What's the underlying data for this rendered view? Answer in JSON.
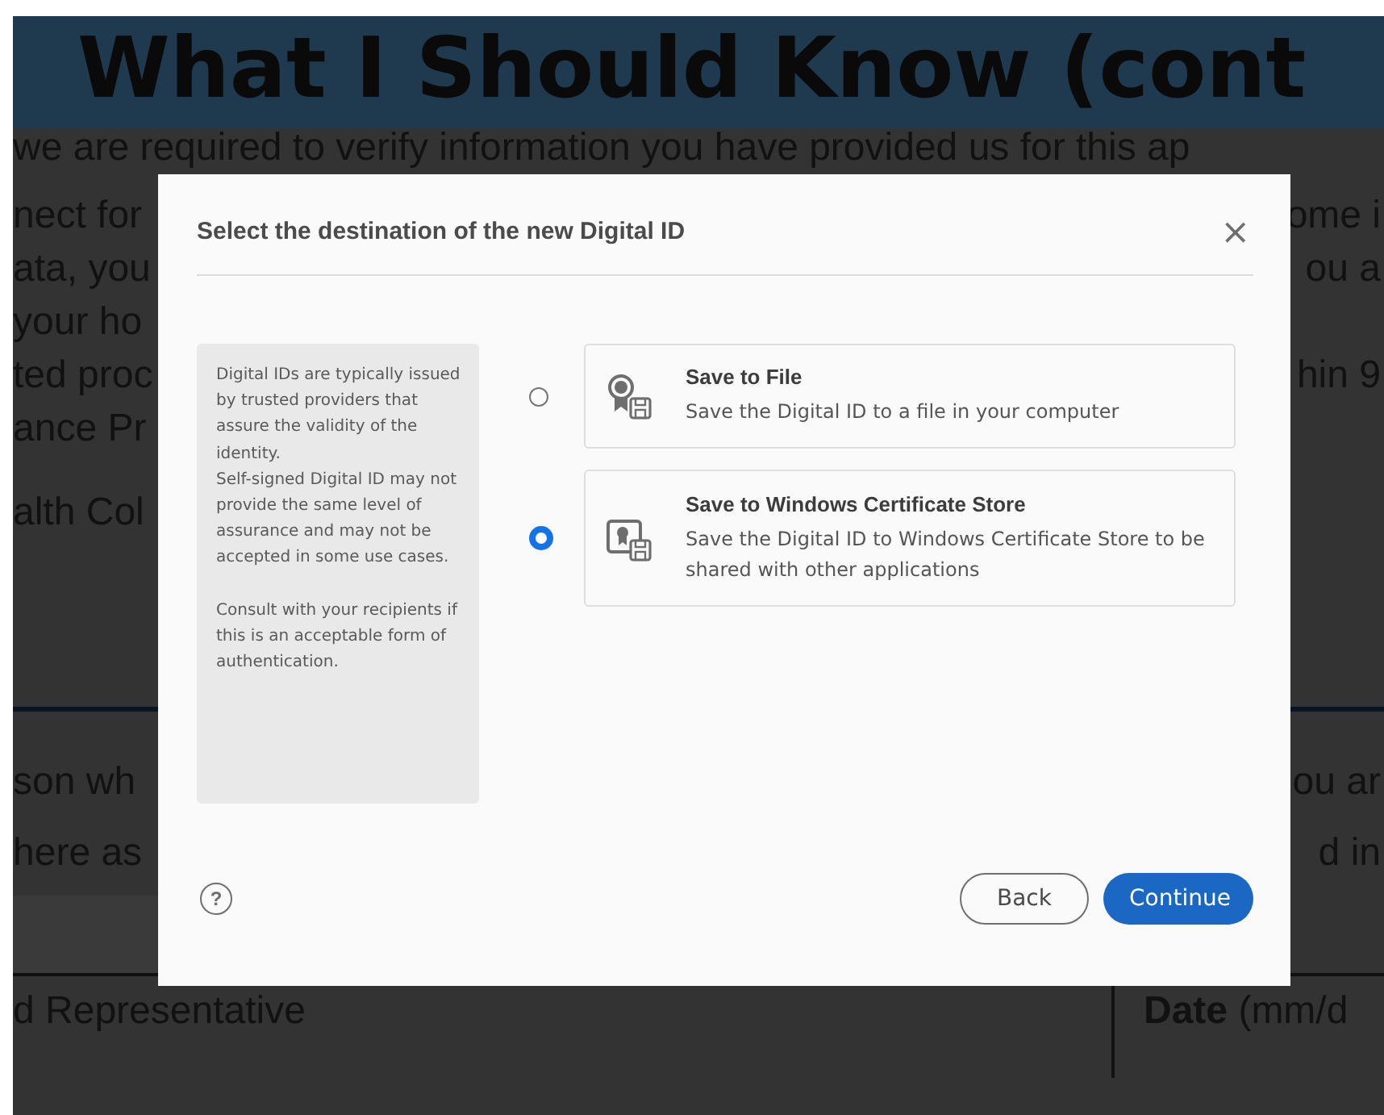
{
  "document": {
    "heading": "What I Should Know (cont",
    "lines": [
      {
        "left": "we are required to verify information you have provided us for this ap"
      },
      {
        "left": "nect for",
        "right": "ome i"
      },
      {
        "left": "ata, you",
        "right": "ou a"
      },
      {
        "left": "your ho"
      },
      {
        "left": "ted proc",
        "right": "hin 9"
      },
      {
        "left": "ance Pr"
      },
      {
        "left": "alth Col"
      }
    ],
    "lower_lines": [
      {
        "left": "son wh",
        "right": "ou ar"
      },
      {
        "left": "here as",
        "right": "d in"
      }
    ],
    "table_cells": [
      "d Representative",
      "**Date** (mm/d"
    ]
  },
  "dialog": {
    "title": "Select the destination of the new Digital ID",
    "close": "×",
    "info_groups": [
      [
        "Digital IDs are typically issued by trusted providers that assure the validity of the identity.",
        "Self-signed Digital ID may not provide the same level of assurance and may not be accepted in some use cases."
      ],
      [
        "Consult with your recipients if this is an acceptable form of authentication."
      ]
    ],
    "options": [
      {
        "kind": "file",
        "title": "Save to File",
        "description": "Save the Digital ID to a file in your computer",
        "selected": false
      },
      {
        "kind": "store",
        "title": "Save to Windows Certificate Store",
        "description": "Save the Digital ID to Windows Certificate Store to be shared with other applications",
        "selected": true
      }
    ],
    "help": "?",
    "buttons": [
      {
        "kind": "secondary",
        "label": "Back"
      },
      {
        "kind": "primary",
        "label": "Continue"
      }
    ]
  }
}
